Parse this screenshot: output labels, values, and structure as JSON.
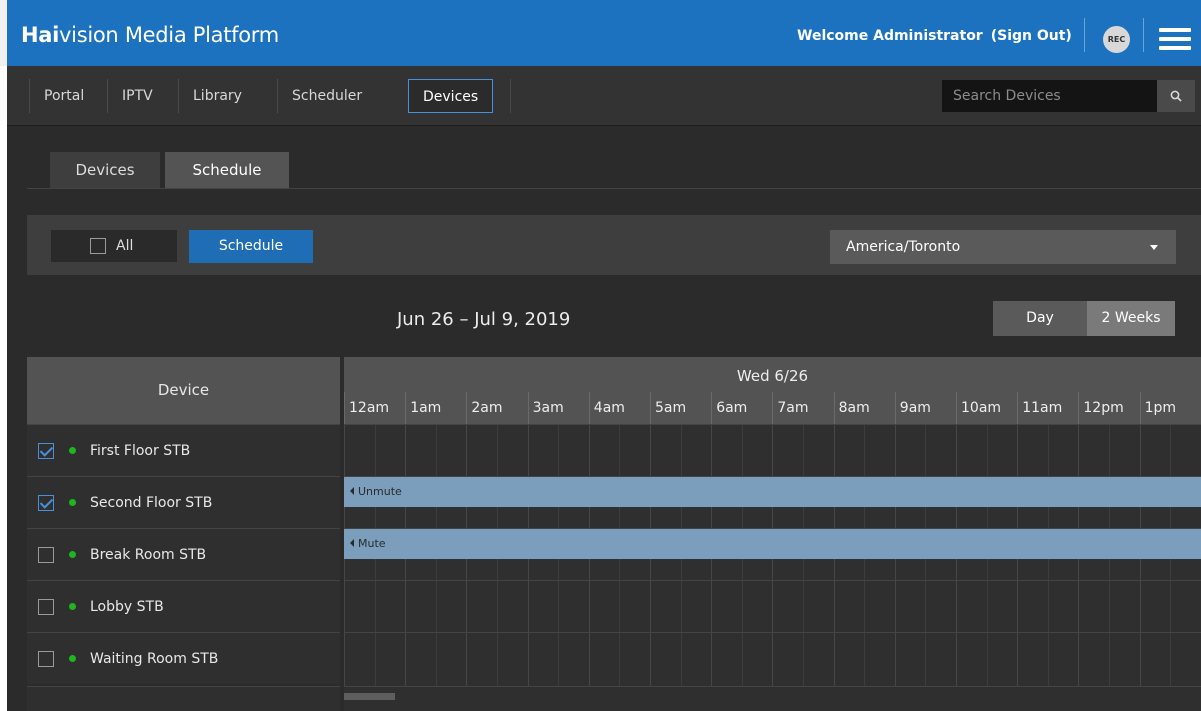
{
  "header": {
    "brand_bold": "Hai",
    "brand_rest": "vision Media Platform",
    "welcome": "Welcome Administrator",
    "sign_out": "(Sign Out)",
    "rec_label": "REC",
    "menu_icon": "hamburger-menu-icon"
  },
  "nav": {
    "items": [
      {
        "label": "Portal"
      },
      {
        "label": "IPTV"
      },
      {
        "label": "Library"
      },
      {
        "label": "Scheduler"
      },
      {
        "label": "Devices"
      }
    ],
    "active": "Devices",
    "search_placeholder": "Search Devices",
    "search_icon": "search-icon"
  },
  "subtabs": {
    "items": [
      {
        "label": "Devices"
      },
      {
        "label": "Schedule"
      }
    ],
    "active": "Schedule"
  },
  "toolbar": {
    "all_label": "All",
    "all_checked": false,
    "schedule_button": "Schedule",
    "timezone": "America/Toronto"
  },
  "range": {
    "label": "Jun 26 – Jul 9, 2019",
    "day_button": "Day",
    "weeks_button": "2 Weeks",
    "active_view": "2 Weeks"
  },
  "device_table": {
    "header": "Device",
    "rows": [
      {
        "name": "First Floor STB",
        "checked": true,
        "status": "online"
      },
      {
        "name": "Second Floor STB",
        "checked": true,
        "status": "online"
      },
      {
        "name": "Break Room STB",
        "checked": false,
        "status": "online"
      },
      {
        "name": "Lobby STB",
        "checked": false,
        "status": "online"
      },
      {
        "name": "Waiting Room STB",
        "checked": false,
        "status": "online"
      }
    ]
  },
  "timeline": {
    "date": "Wed 6/26",
    "hours": [
      "12am",
      "1am",
      "2am",
      "3am",
      "4am",
      "5am",
      "6am",
      "7am",
      "8am",
      "9am",
      "10am",
      "11am",
      "12pm",
      "1pm"
    ],
    "events": [
      {
        "row": 1,
        "label": "Unmute"
      },
      {
        "row": 2,
        "label": "Mute"
      }
    ]
  },
  "colors": {
    "header_blue": "#1d72c0",
    "primary_button": "#1f6db5",
    "event_bar": "#7c9ebd",
    "status_online": "#1fb51f",
    "checkbox_accent": "#4a90d9"
  }
}
